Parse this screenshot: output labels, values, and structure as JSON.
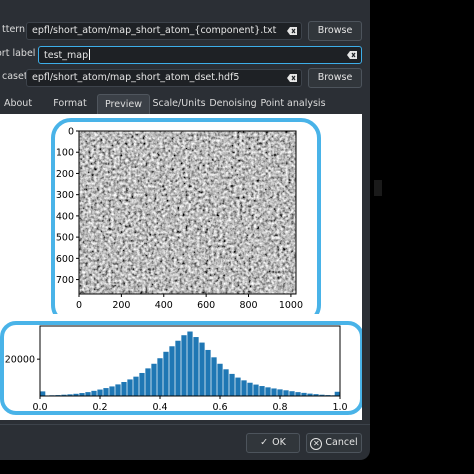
{
  "fields": {
    "pattern": {
      "label": "ttern",
      "value": "epfl/short_atom/map_short_atom_{component}.txt",
      "browse": "Browse"
    },
    "short_label": {
      "label": "ort label",
      "value": "test_map"
    },
    "dataset": {
      "label": "caset",
      "value": "epfl/short_atom/map_short_atom_dset.hdf5",
      "browse": "Browse"
    }
  },
  "tabs": [
    {
      "label": "About"
    },
    {
      "label": "Format"
    },
    {
      "label": "Preview",
      "selected": true
    },
    {
      "label": "Scale/Units"
    },
    {
      "label": "Denoising"
    },
    {
      "label": "Point analysis"
    }
  ],
  "footer": {
    "ok": "OK",
    "cancel": "Cancel"
  },
  "chart_data": [
    {
      "type": "heatmap",
      "description_source": "grayscale microscopy image preview",
      "x_ticks": [
        "0",
        "200",
        "400",
        "600",
        "800",
        "1000"
      ],
      "y_ticks": [
        "0",
        "100",
        "200",
        "300",
        "400",
        "500",
        "600",
        "700"
      ],
      "xlim": [
        0,
        1024
      ],
      "ylim": [
        768,
        0
      ]
    },
    {
      "type": "bar",
      "x_ticks": [
        "0.0",
        "0.2",
        "0.4",
        "0.6",
        "0.8",
        "1.0"
      ],
      "y_ticks": [
        "20000"
      ],
      "xlim": [
        0,
        1
      ],
      "ylim": [
        0,
        38000
      ],
      "bins_center": [
        0.0,
        0.02,
        0.04,
        0.06,
        0.08,
        0.1,
        0.12,
        0.14,
        0.16,
        0.18,
        0.2,
        0.22,
        0.24,
        0.26,
        0.28,
        0.3,
        0.32,
        0.34,
        0.36,
        0.38,
        0.4,
        0.42,
        0.44,
        0.46,
        0.48,
        0.5,
        0.52,
        0.54,
        0.56,
        0.58,
        0.6,
        0.62,
        0.64,
        0.66,
        0.68,
        0.7,
        0.72,
        0.74,
        0.76,
        0.78,
        0.8,
        0.82,
        0.84,
        0.86,
        0.88,
        0.9,
        0.92,
        0.94,
        0.96,
        0.98,
        1.0
      ],
      "values": [
        2500,
        300,
        400,
        500,
        700,
        900,
        1200,
        1600,
        2100,
        2800,
        3500,
        4300,
        5200,
        6300,
        7600,
        9000,
        10500,
        12500,
        15000,
        17500,
        20500,
        24000,
        27000,
        30000,
        33000,
        35000,
        32000,
        29000,
        25000,
        21000,
        17500,
        14500,
        12000,
        10000,
        8500,
        7200,
        6200,
        5400,
        4700,
        4100,
        3600,
        3100,
        2600,
        2100,
        1700,
        1300,
        1000,
        700,
        500,
        400,
        2300
      ]
    }
  ]
}
